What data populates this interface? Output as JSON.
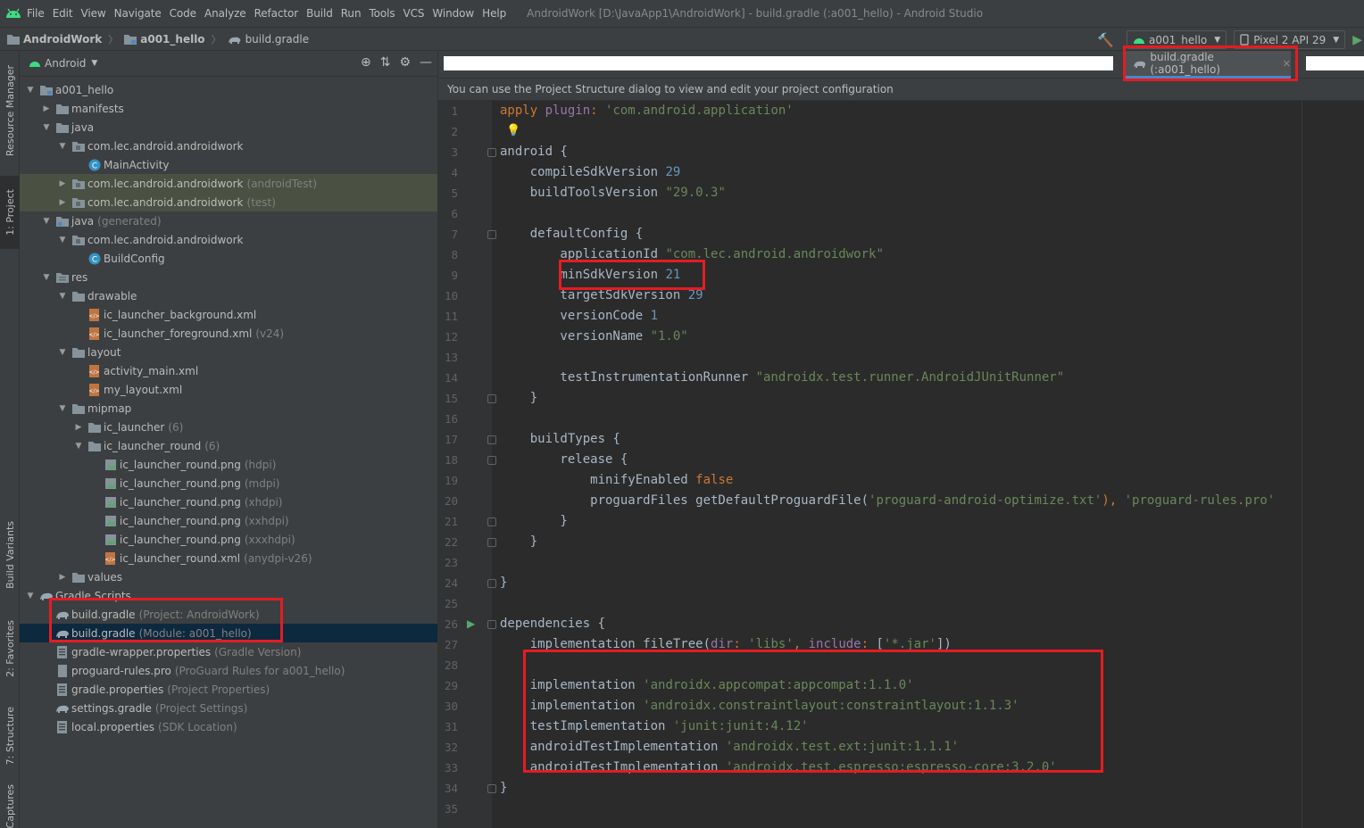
{
  "menubar": {
    "items": [
      "File",
      "Edit",
      "View",
      "Navigate",
      "Code",
      "Analyze",
      "Refactor",
      "Build",
      "Run",
      "Tools",
      "VCS",
      "Window",
      "Help"
    ],
    "window_title": "AndroidWork [D:\\JavaApp1\\AndroidWork] - build.gradle (:a001_hello) - Android Studio"
  },
  "navbar": {
    "crumbs": [
      "AndroidWork",
      "a001_hello",
      "build.gradle"
    ],
    "run_config": "a001_hello",
    "device": "Pixel 2 API 29"
  },
  "left_stripe": {
    "tabs": [
      "Resource Manager",
      "1: Project",
      "Build Variants",
      "2: Favorites",
      "7: Structure",
      "Captures"
    ]
  },
  "project_panel": {
    "view_mode": "Android",
    "tree": [
      {
        "name": "a001_hello",
        "suffix": "",
        "depth": 0,
        "arrow": "down",
        "icon": "module"
      },
      {
        "name": "manifests",
        "suffix": "",
        "depth": 1,
        "arrow": "right",
        "icon": "folder"
      },
      {
        "name": "java",
        "suffix": "",
        "depth": 1,
        "arrow": "down",
        "icon": "folder"
      },
      {
        "name": "com.lec.android.androidwork",
        "suffix": "",
        "depth": 2,
        "arrow": "down",
        "icon": "package"
      },
      {
        "name": "MainActivity",
        "suffix": "",
        "depth": 3,
        "arrow": "",
        "icon": "class"
      },
      {
        "name": "com.lec.android.androidwork",
        "suffix": "(androidTest)",
        "depth": 2,
        "arrow": "right",
        "icon": "package",
        "style": "hl"
      },
      {
        "name": "com.lec.android.androidwork",
        "suffix": "(test)",
        "depth": 2,
        "arrow": "right",
        "icon": "package",
        "style": "hl"
      },
      {
        "name": "java",
        "suffix": "(generated)",
        "depth": 1,
        "arrow": "down",
        "icon": "folder-gen"
      },
      {
        "name": "com.lec.android.androidwork",
        "suffix": "",
        "depth": 2,
        "arrow": "down",
        "icon": "package"
      },
      {
        "name": "BuildConfig",
        "suffix": "",
        "depth": 3,
        "arrow": "",
        "icon": "class"
      },
      {
        "name": "res",
        "suffix": "",
        "depth": 1,
        "arrow": "down",
        "icon": "res"
      },
      {
        "name": "drawable",
        "suffix": "",
        "depth": 2,
        "arrow": "down",
        "icon": "folder"
      },
      {
        "name": "ic_launcher_background.xml",
        "suffix": "",
        "depth": 3,
        "arrow": "",
        "icon": "xml"
      },
      {
        "name": "ic_launcher_foreground.xml",
        "suffix": "(v24)",
        "depth": 3,
        "arrow": "",
        "icon": "xml"
      },
      {
        "name": "layout",
        "suffix": "",
        "depth": 2,
        "arrow": "down",
        "icon": "folder"
      },
      {
        "name": "activity_main.xml",
        "suffix": "",
        "depth": 3,
        "arrow": "",
        "icon": "xml"
      },
      {
        "name": "my_layout.xml",
        "suffix": "",
        "depth": 3,
        "arrow": "",
        "icon": "xml"
      },
      {
        "name": "mipmap",
        "suffix": "",
        "depth": 2,
        "arrow": "down",
        "icon": "folder"
      },
      {
        "name": "ic_launcher",
        "suffix": "(6)",
        "depth": 3,
        "arrow": "right",
        "icon": "folder"
      },
      {
        "name": "ic_launcher_round",
        "suffix": "(6)",
        "depth": 3,
        "arrow": "down",
        "icon": "folder"
      },
      {
        "name": "ic_launcher_round.png",
        "suffix": "(hdpi)",
        "depth": 4,
        "arrow": "",
        "icon": "png"
      },
      {
        "name": "ic_launcher_round.png",
        "suffix": "(mdpi)",
        "depth": 4,
        "arrow": "",
        "icon": "png"
      },
      {
        "name": "ic_launcher_round.png",
        "suffix": "(xhdpi)",
        "depth": 4,
        "arrow": "",
        "icon": "png"
      },
      {
        "name": "ic_launcher_round.png",
        "suffix": "(xxhdpi)",
        "depth": 4,
        "arrow": "",
        "icon": "png"
      },
      {
        "name": "ic_launcher_round.png",
        "suffix": "(xxxhdpi)",
        "depth": 4,
        "arrow": "",
        "icon": "png"
      },
      {
        "name": "ic_launcher_round.xml",
        "suffix": "(anydpi-v26)",
        "depth": 4,
        "arrow": "",
        "icon": "xml"
      },
      {
        "name": "values",
        "suffix": "",
        "depth": 2,
        "arrow": "right",
        "icon": "folder"
      },
      {
        "name": "Gradle Scripts",
        "suffix": "",
        "depth": 0,
        "arrow": "down",
        "icon": "gradle"
      },
      {
        "name": "build.gradle",
        "suffix": "(Project: AndroidWork)",
        "depth": 1,
        "arrow": "",
        "icon": "gradle"
      },
      {
        "name": "build.gradle",
        "suffix": "(Module: a001_hello)",
        "depth": 1,
        "arrow": "",
        "icon": "gradle",
        "style": "sel"
      },
      {
        "name": "gradle-wrapper.properties",
        "suffix": "(Gradle Version)",
        "depth": 1,
        "arrow": "",
        "icon": "props"
      },
      {
        "name": "proguard-rules.pro",
        "suffix": "(ProGuard Rules for a001_hello)",
        "depth": 1,
        "arrow": "",
        "icon": "file"
      },
      {
        "name": "gradle.properties",
        "suffix": "(Project Properties)",
        "depth": 1,
        "arrow": "",
        "icon": "props"
      },
      {
        "name": "settings.gradle",
        "suffix": "(Project Settings)",
        "depth": 1,
        "arrow": "",
        "icon": "gradle"
      },
      {
        "name": "local.properties",
        "suffix": "(SDK Location)",
        "depth": 1,
        "arrow": "",
        "icon": "props"
      }
    ]
  },
  "editor": {
    "tab_label": "build.gradle (:a001_hello)",
    "info_bar": "You can use the Project Structure dialog to view and edit your project configuration",
    "lines": [
      [
        [
          "kw",
          "apply "
        ],
        [
          "pp",
          "plugin"
        ],
        [
          "",
          ""
        ],
        [
          "kw",
          ": "
        ],
        [
          "st",
          "'com.android.application'"
        ]
      ],
      [],
      [
        [
          "",
          "android {"
        ]
      ],
      [
        [
          "",
          "    compileSdkVersion "
        ],
        [
          "nu",
          "29"
        ]
      ],
      [
        [
          "",
          "    buildToolsVersion "
        ],
        [
          "st",
          "\"29.0.3\""
        ]
      ],
      [],
      [
        [
          "",
          "    defaultConfig {"
        ]
      ],
      [
        [
          "",
          "        applicationId "
        ],
        [
          "st",
          "\"com.lec.android.androidwork\""
        ]
      ],
      [
        [
          "",
          "        minSdkVersion "
        ],
        [
          "nu",
          "21"
        ]
      ],
      [
        [
          "",
          "        targetSdkVersion "
        ],
        [
          "nu",
          "29"
        ]
      ],
      [
        [
          "",
          "        versionCode "
        ],
        [
          "nu",
          "1"
        ]
      ],
      [
        [
          "",
          "        versionName "
        ],
        [
          "st",
          "\"1.0\""
        ]
      ],
      [],
      [
        [
          "",
          "        testInstrumentationRunner "
        ],
        [
          "st",
          "\"androidx.test.runner.AndroidJUnitRunner\""
        ]
      ],
      [
        [
          "",
          "    }"
        ]
      ],
      [],
      [
        [
          "",
          "    buildTypes {"
        ]
      ],
      [
        [
          "",
          "        release {"
        ]
      ],
      [
        [
          "",
          "            minifyEnabled "
        ],
        [
          "kw",
          "false"
        ]
      ],
      [
        [
          "",
          "            proguardFiles getDefaultProguardFile("
        ],
        [
          "st",
          "'proguard-android-optimize.txt'"
        ],
        [
          "kw",
          "), "
        ],
        [
          "st",
          "'proguard-rules.pro'"
        ]
      ],
      [
        [
          "",
          "        }"
        ]
      ],
      [
        [
          "",
          "    }"
        ]
      ],
      [],
      [
        [
          "",
          "}"
        ]
      ],
      [],
      [
        [
          "",
          "dependencies {"
        ]
      ],
      [
        [
          "",
          "    implementation fileTree("
        ],
        [
          "pp",
          "dir"
        ],
        [
          "kw",
          ": "
        ],
        [
          "st",
          "'libs'"
        ],
        [
          "kw",
          ", "
        ],
        [
          "pp",
          "include"
        ],
        [
          "kw",
          ": "
        ],
        [
          "",
          "["
        ],
        [
          "st",
          "'*.jar'"
        ],
        [
          "",
          "])"
        ]
      ],
      [],
      [
        [
          "",
          "    implementation "
        ],
        [
          "st",
          "'androidx.appcompat:appcompat:1.1.0'"
        ]
      ],
      [
        [
          "",
          "    implementation "
        ],
        [
          "st",
          "'androidx.constraintlayout:constraintlayout:1.1.3'"
        ]
      ],
      [
        [
          "",
          "    testImplementation "
        ],
        [
          "st",
          "'junit:junit:4.12'"
        ]
      ],
      [
        [
          "",
          "    androidTestImplementation "
        ],
        [
          "st",
          "'androidx.test.ext:junit:1.1.1'"
        ]
      ],
      [
        [
          "",
          "    androidTestImplementation "
        ],
        [
          "st",
          "'androidx.test.espresso:espresso-core:3.2.0'"
        ]
      ],
      [
        [
          "",
          "}"
        ]
      ],
      []
    ]
  },
  "colors": {
    "highlight_box": "#e51c23",
    "keyword": "#cc7832",
    "string": "#6a8759",
    "number": "#6897bb",
    "param": "#9876aa",
    "selection": "#0d293e"
  }
}
